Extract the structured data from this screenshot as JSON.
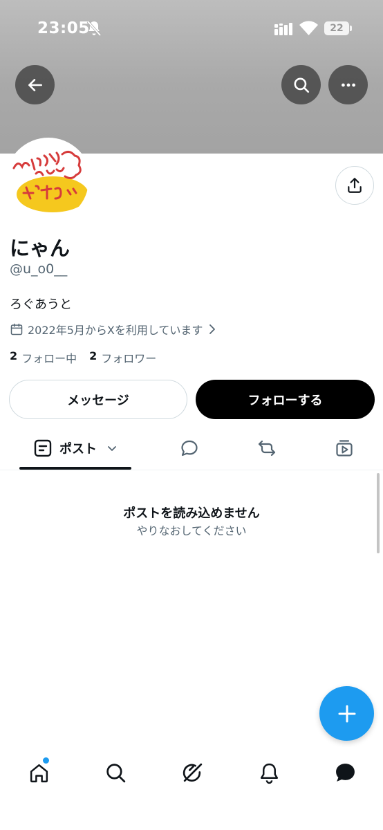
{
  "status_bar": {
    "time": "23:05",
    "battery": "22"
  },
  "header": {
    "back_icon": "arrow-left-icon",
    "search_icon": "search-icon",
    "more_icon": "more-horizontal-icon"
  },
  "avatar": {
    "icon": "avatar-illustration",
    "colors": {
      "ink": "#d63b3b",
      "fill": "#f5c81e"
    }
  },
  "profile": {
    "display_name": "にゃん",
    "handle": "@u_o0__",
    "bio": "ろぐあうと",
    "joined_text": "2022年5月からXを利用しています",
    "following_count": "2",
    "following_label": "フォロー中",
    "followers_count": "2",
    "followers_label": "フォロワー"
  },
  "actions": {
    "message_label": "メッセージ",
    "follow_label": "フォローする"
  },
  "tabs": {
    "posts_label": "ポスト",
    "items": [
      "posts",
      "replies",
      "reposts",
      "media"
    ]
  },
  "error": {
    "title": "ポストを読み込めません",
    "subtitle": "やりなおしてください"
  },
  "colors": {
    "accent": "#1d9bf0",
    "text": "#0f1419",
    "secondary": "#536471",
    "follow_button": "#000000"
  },
  "bottom_nav": [
    "home-icon",
    "search-icon",
    "grok-icon",
    "notifications-icon",
    "messages-icon"
  ]
}
